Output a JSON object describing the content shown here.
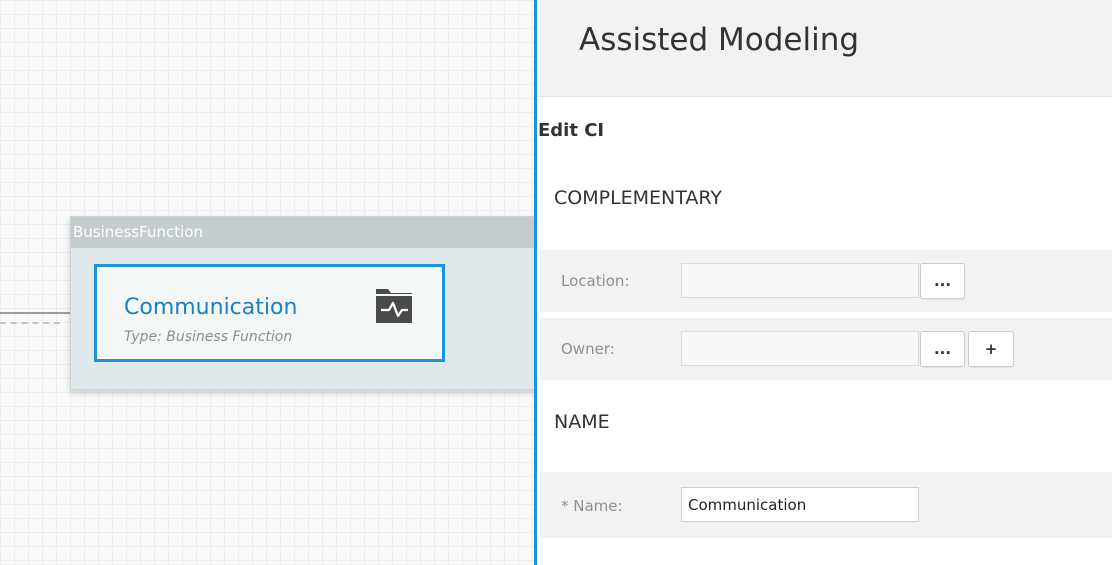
{
  "canvas": {
    "group": {
      "header": "BusinessFunction",
      "node": {
        "title": "Communication",
        "type_text": "Type: Business Function",
        "icon": "business-function-icon"
      }
    }
  },
  "panel": {
    "title": "Assisted Modeling",
    "edit_label": "Edit CI",
    "sections": {
      "complementary": {
        "title": "COMPLEMENTARY",
        "location": {
          "label": "Location:",
          "value": "",
          "browse_label": "..."
        },
        "owner": {
          "label": "Owner:",
          "value": "",
          "browse_label": "...",
          "add_label": "+"
        }
      },
      "name": {
        "title": "NAME",
        "name_field": {
          "label": "* Name:",
          "value": "Communication"
        }
      }
    }
  },
  "colors": {
    "accent": "#1b95d8",
    "node_title": "#1a82c4",
    "group_header": "#c5ccce",
    "group_body": "#dfe9eb"
  }
}
